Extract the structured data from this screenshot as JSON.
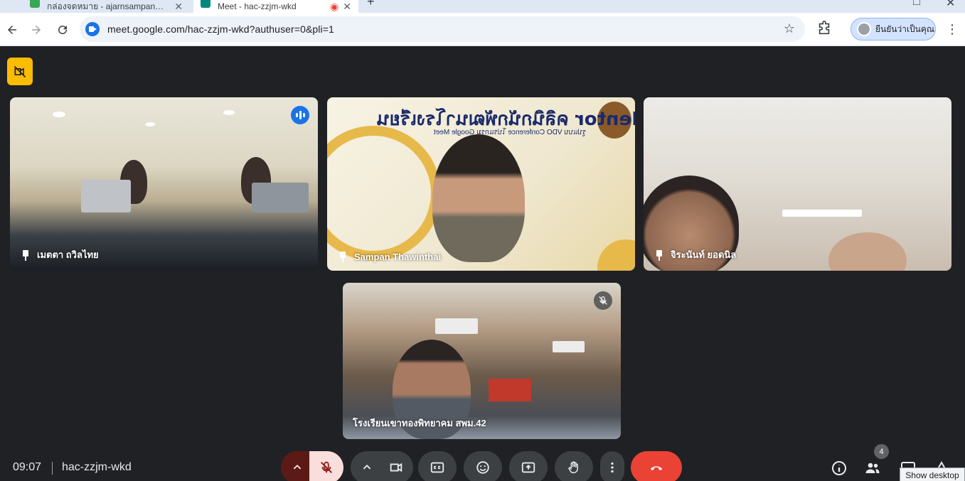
{
  "browser": {
    "tabs": [
      {
        "label": "กล่องจดหมาย - ajarnsampan@gm",
        "active": false
      },
      {
        "label": "Meet - hac-zzjm-wkd",
        "active": true
      }
    ],
    "new_tab": "+",
    "url": "meet.google.com/hac-zzjm-wkd?authuser=0&pli=1",
    "profile_label": "ยืนยันว่าเป็นคุณ"
  },
  "meeting": {
    "time": "09:07",
    "code": "hac-zzjm-wkd",
    "participants_count": "4",
    "tooltip": "Show desktop"
  },
  "tiles": [
    {
      "name": "เมตตา ถวิลไทย",
      "speaking": true,
      "muted": false
    },
    {
      "name": "Sampan Thawinthai",
      "speaking": false,
      "muted": false
    },
    {
      "name": "จิระนันท์ ยอดนิล",
      "speaking": false,
      "muted": false
    },
    {
      "name": "โรงเรียนเขาทองพิทยาคม สพม.42",
      "speaking": false,
      "muted": true
    }
  ],
  "slide": {
    "title": "QA Mentor คลินิกนักพัฒนาโรงเรียน",
    "subtitle": "รูปแบบ VDO Conference โปรแกรม Google Meet"
  },
  "colors": {
    "meet_bg": "#202124",
    "end_call": "#ea4335",
    "mic_off": "#f9dedc",
    "camera_off_badge": "#fbbc04",
    "speaking_indicator": "#1a73e8"
  }
}
